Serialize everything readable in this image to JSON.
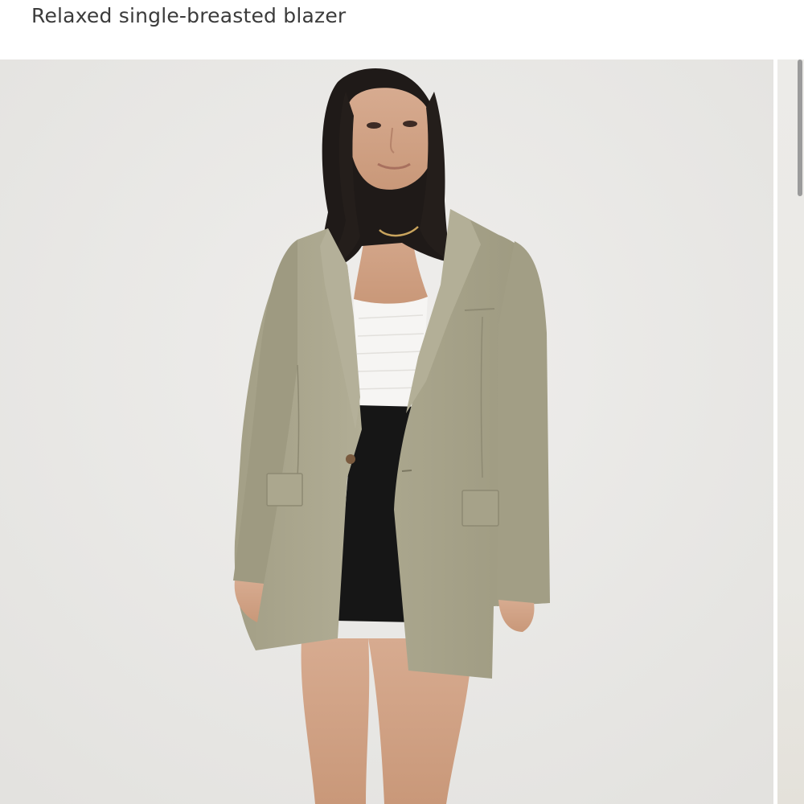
{
  "product": {
    "title": "Relaxed single-breasted blazer"
  },
  "gallery": {
    "main_image": "model-wearing-khaki-blazer",
    "next_image": "next-product-photo-peek"
  },
  "colors": {
    "background": "#ffffff",
    "backdrop": "#ecebea",
    "blazer": "#a9a58c",
    "top": "#f6f5f3",
    "skirt": "#161616",
    "title_text": "#3b3b3b"
  },
  "icons": {
    "scroll_indicator": "scrollbar-thumb"
  }
}
